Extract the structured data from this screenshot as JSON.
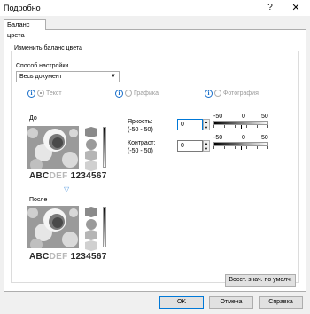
{
  "window": {
    "title": "Подробно",
    "help": "?",
    "close": "✕"
  },
  "tabs": [
    {
      "label": "Баланс цвета"
    }
  ],
  "group": {
    "title": "Изменить баланс цвета",
    "method_label": "Способ настройки",
    "method_value": "Весь документ",
    "radios": [
      {
        "label": "Текст",
        "checked": true
      },
      {
        "label": "Графика",
        "checked": false
      },
      {
        "label": "Фотография",
        "checked": false
      }
    ],
    "before_label": "До",
    "after_label": "После",
    "sample_abc": "ABC",
    "sample_def": "DEF",
    "sample_num": "1234567",
    "brightness": {
      "label": "Яркость:",
      "range": "(-50 - 50)",
      "value": "0"
    },
    "contrast": {
      "label": "Контраст:",
      "range": "(-50 - 50)",
      "value": "0"
    },
    "scale": {
      "min": "-50",
      "mid": "0",
      "max": "50"
    },
    "restore_button": "Восст. знач. по умолч."
  },
  "footer": {
    "ok": "OK",
    "cancel": "Отмена",
    "help": "Справка"
  },
  "colors": {
    "accent": "#0078d7",
    "info": "#1a6fc9",
    "arrow": "#5a9ce0"
  }
}
